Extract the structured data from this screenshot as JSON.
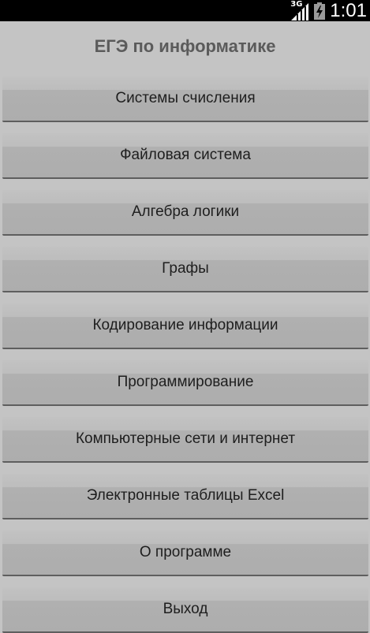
{
  "status_bar": {
    "network": "3G",
    "time": "1:01",
    "icons": [
      "signal-3g-icon",
      "battery-charging-icon"
    ]
  },
  "app": {
    "title": "ЕГЭ по информатике"
  },
  "menu": {
    "items": [
      {
        "label": "Системы счисления"
      },
      {
        "label": "Файловая система"
      },
      {
        "label": "Алгебра логики"
      },
      {
        "label": "Графы"
      },
      {
        "label": "Кодирование информации"
      },
      {
        "label": "Программирование"
      },
      {
        "label": "Компьютерные сети и интернет"
      },
      {
        "label": "Электронные таблицы Excel"
      },
      {
        "label": "О программе"
      },
      {
        "label": "Выход"
      }
    ]
  }
}
